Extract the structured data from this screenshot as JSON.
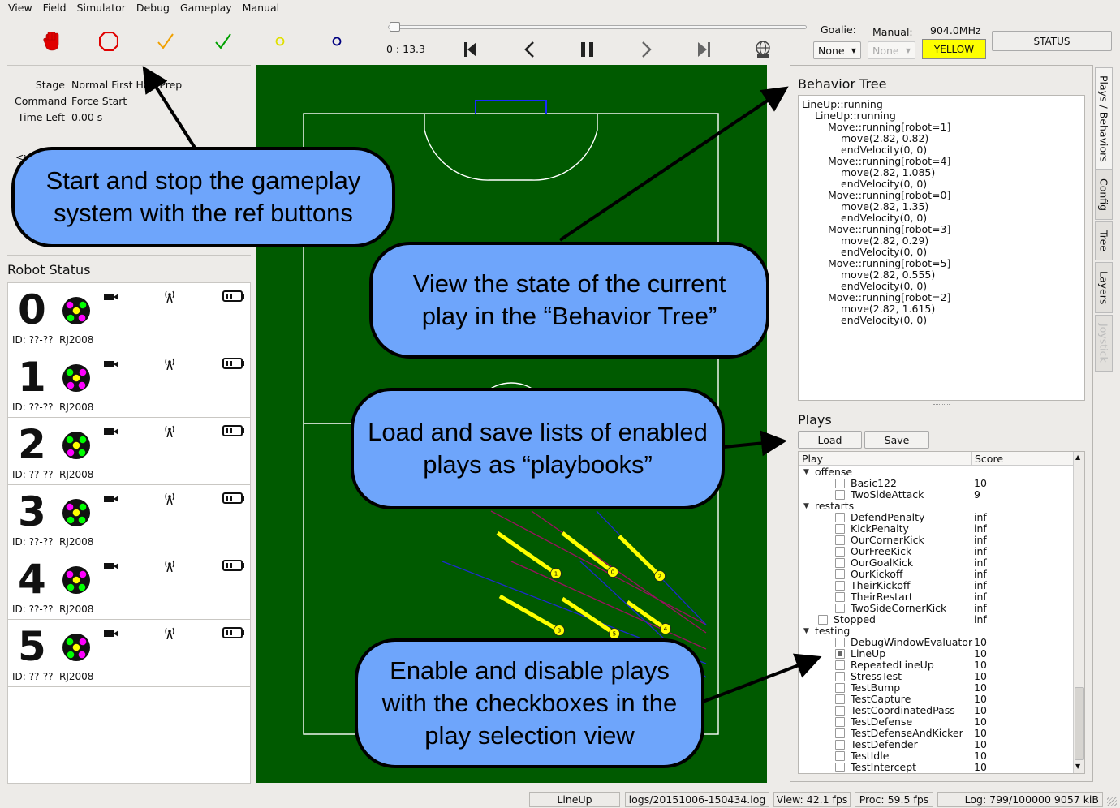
{
  "menu": [
    "View",
    "Field",
    "Simulator",
    "Debug",
    "Gameplay",
    "Manual"
  ],
  "ref_buttons": [
    {
      "name": "halt-icon",
      "color": "#e00000"
    },
    {
      "name": "stop-icon",
      "color": "#e00000"
    },
    {
      "name": "ready-icon",
      "color": "#f0a000"
    },
    {
      "name": "force-start-icon",
      "color": "#00a000"
    },
    {
      "name": "yellow-circle-icon",
      "color": "#e0e000"
    },
    {
      "name": "blue-circle-icon",
      "color": "#000080"
    }
  ],
  "playback": {
    "time": "0 : 13.3"
  },
  "controls": {
    "goalie_label": "Goalie:",
    "goalie_value": "None",
    "manual_label": "Manual:",
    "manual_value": "None",
    "radio_freq": "904.0MHz",
    "team_button": "YELLOW",
    "status_button": "STATUS"
  },
  "game_state": {
    "stage_label": "Stage",
    "stage_value": "Normal First Half Prep",
    "command_label": "Command",
    "command_value": "Force Start",
    "time_label": "Time Left",
    "time_value": "0.00 s",
    "partial_text": "<v"
  },
  "robot_status": {
    "title": "Robot Status",
    "robots": [
      {
        "num": "0",
        "id": "ID: ??-??",
        "hw": "RJ2008",
        "dots": [
          "#ff00ff",
          "#ffff00",
          "#00ff00",
          "#00ff00",
          "#ff00ff"
        ]
      },
      {
        "num": "1",
        "id": "ID: ??-??",
        "hw": "RJ2008",
        "dots": [
          "#00ff00",
          "#ffff00",
          "#ff00ff",
          "#ff00ff",
          "#ff00ff"
        ]
      },
      {
        "num": "2",
        "id": "ID: ??-??",
        "hw": "RJ2008",
        "dots": [
          "#00ff00",
          "#ffff00",
          "#00ff00",
          "#ff00ff",
          "#00ff00"
        ]
      },
      {
        "num": "3",
        "id": "ID: ??-??",
        "hw": "RJ2008",
        "dots": [
          "#ff00ff",
          "#ffff00",
          "#00ff00",
          "#00ff00",
          "#00ff00"
        ]
      },
      {
        "num": "4",
        "id": "ID: ??-??",
        "hw": "RJ2008",
        "dots": [
          "#ff00ff",
          "#ffff00",
          "#ff00ff",
          "#00ff00",
          "#00ff00"
        ]
      },
      {
        "num": "5",
        "id": "ID: ??-??",
        "hw": "RJ2008",
        "dots": [
          "#00ff00",
          "#ffff00",
          "#ff00ff",
          "#00ff00",
          "#ff00ff"
        ]
      }
    ]
  },
  "field": {
    "robots": [
      {
        "label": "1"
      },
      {
        "label": "0"
      },
      {
        "label": "2"
      },
      {
        "label": "3"
      },
      {
        "label": "5"
      },
      {
        "label": "4"
      }
    ]
  },
  "behavior_tree": {
    "title": "Behavior Tree",
    "lines": [
      {
        "indent": 0,
        "text": "LineUp::running"
      },
      {
        "indent": 1,
        "text": "LineUp::running"
      },
      {
        "indent": 2,
        "text": "Move::running[robot=1]"
      },
      {
        "indent": 3,
        "text": "move(2.82, 0.82)"
      },
      {
        "indent": 3,
        "text": "endVelocity(0, 0)"
      },
      {
        "indent": 2,
        "text": "Move::running[robot=4]"
      },
      {
        "indent": 3,
        "text": "move(2.82, 1.085)"
      },
      {
        "indent": 3,
        "text": "endVelocity(0, 0)"
      },
      {
        "indent": 2,
        "text": "Move::running[robot=0]"
      },
      {
        "indent": 3,
        "text": "move(2.82, 1.35)"
      },
      {
        "indent": 3,
        "text": "endVelocity(0, 0)"
      },
      {
        "indent": 2,
        "text": "Move::running[robot=3]"
      },
      {
        "indent": 3,
        "text": "move(2.82, 0.29)"
      },
      {
        "indent": 3,
        "text": "endVelocity(0, 0)"
      },
      {
        "indent": 2,
        "text": "Move::running[robot=5]"
      },
      {
        "indent": 3,
        "text": "move(2.82, 0.555)"
      },
      {
        "indent": 3,
        "text": "endVelocity(0, 0)"
      },
      {
        "indent": 2,
        "text": "Move::running[robot=2]"
      },
      {
        "indent": 3,
        "text": "move(2.82, 1.615)"
      },
      {
        "indent": 3,
        "text": "endVelocity(0, 0)"
      }
    ]
  },
  "plays": {
    "title": "Plays",
    "load_label": "Load",
    "save_label": "Save",
    "col_play": "Play",
    "col_score": "Score",
    "rows": [
      {
        "type": "group",
        "name": "offense"
      },
      {
        "type": "play",
        "name": "Basic122",
        "score": "10",
        "checked": false
      },
      {
        "type": "play",
        "name": "TwoSideAttack",
        "score": "9",
        "checked": false
      },
      {
        "type": "group",
        "name": "restarts"
      },
      {
        "type": "play",
        "name": "DefendPenalty",
        "score": "inf",
        "checked": false
      },
      {
        "type": "play",
        "name": "KickPenalty",
        "score": "inf",
        "checked": false
      },
      {
        "type": "play",
        "name": "OurCornerKick",
        "score": "inf",
        "checked": false
      },
      {
        "type": "play",
        "name": "OurFreeKick",
        "score": "inf",
        "checked": false
      },
      {
        "type": "play",
        "name": "OurGoalKick",
        "score": "inf",
        "checked": false
      },
      {
        "type": "play",
        "name": "OurKickoff",
        "score": "inf",
        "checked": false
      },
      {
        "type": "play",
        "name": "TheirKickoff",
        "score": "inf",
        "checked": false
      },
      {
        "type": "play",
        "name": "TheirRestart",
        "score": "inf",
        "checked": false
      },
      {
        "type": "play",
        "name": "TwoSideCornerKick",
        "score": "inf",
        "checked": false
      },
      {
        "type": "top",
        "name": "Stopped",
        "score": "inf",
        "checked": false
      },
      {
        "type": "group",
        "name": "testing"
      },
      {
        "type": "play",
        "name": "DebugWindowEvaluator",
        "score": "10",
        "checked": false
      },
      {
        "type": "play",
        "name": "LineUp",
        "score": "10",
        "checked": true
      },
      {
        "type": "play",
        "name": "RepeatedLineUp",
        "score": "10",
        "checked": false
      },
      {
        "type": "play",
        "name": "StressTest",
        "score": "10",
        "checked": false
      },
      {
        "type": "play",
        "name": "TestBump",
        "score": "10",
        "checked": false
      },
      {
        "type": "play",
        "name": "TestCapture",
        "score": "10",
        "checked": false
      },
      {
        "type": "play",
        "name": "TestCoordinatedPass",
        "score": "10",
        "checked": false
      },
      {
        "type": "play",
        "name": "TestDefense",
        "score": "10",
        "checked": false
      },
      {
        "type": "play",
        "name": "TestDefenseAndKicker",
        "score": "10",
        "checked": false
      },
      {
        "type": "play",
        "name": "TestDefender",
        "score": "10",
        "checked": false
      },
      {
        "type": "play",
        "name": "TestIdle",
        "score": "10",
        "checked": false
      },
      {
        "type": "play",
        "name": "TestIntercept",
        "score": "10",
        "checked": false
      }
    ]
  },
  "tabs": [
    {
      "label": "Plays / Behaviors",
      "active": true,
      "enabled": true
    },
    {
      "label": "Config",
      "active": false,
      "enabled": true
    },
    {
      "label": "Tree",
      "active": false,
      "enabled": true
    },
    {
      "label": "Layers",
      "active": false,
      "enabled": true
    },
    {
      "label": "Joystick",
      "active": false,
      "enabled": false
    }
  ],
  "status_bar": {
    "play": "LineUp",
    "log_file": "logs/20151006-150434.log",
    "view_fps": "View: 42.1 fps",
    "proc_fps": "Proc: 59.5 fps",
    "log_stats": "Log: 799/100000 9057 kiB"
  },
  "callouts": {
    "ref": "Start and stop the gameplay system with the ref buttons",
    "behavior": "View the state of the current play in the “Behavior Tree”",
    "playbooks": "Load and save lists of enabled plays as “playbooks”",
    "checkboxes": "Enable and disable plays with the checkboxes in the play selection view"
  }
}
